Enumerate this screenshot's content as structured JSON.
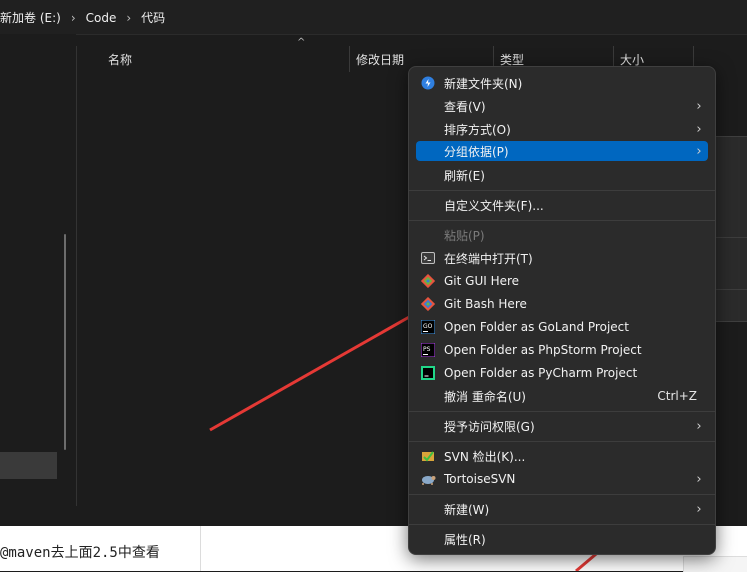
{
  "breadcrumb": {
    "items": [
      "新加卷 (E:)",
      "Code",
      "代码"
    ],
    "separator": "›"
  },
  "columns": [
    "名称",
    "修改日期",
    "类型",
    "大小"
  ],
  "context_menu": {
    "items": [
      {
        "label": "新建文件夹(N)",
        "icon": "new-folder-icon"
      },
      {
        "label": "查看(V)",
        "submenu": true
      },
      {
        "label": "排序方式(O)",
        "submenu": true
      },
      {
        "label": "分组依据(P)",
        "submenu": true,
        "highlighted": true
      },
      {
        "label": "刷新(E)"
      },
      {
        "label": "自定义文件夹(F)..."
      },
      {
        "label": "粘贴(P)",
        "disabled": true
      },
      {
        "label": "在终端中打开(T)",
        "icon": "terminal-icon"
      },
      {
        "label": "Git GUI Here",
        "icon": "git-gui-icon"
      },
      {
        "label": "Git Bash Here",
        "icon": "git-bash-icon"
      },
      {
        "label": "Open Folder as GoLand Project",
        "icon": "goland-icon"
      },
      {
        "label": "Open Folder as PhpStorm Project",
        "icon": "phpstorm-icon"
      },
      {
        "label": "Open Folder as PyCharm Project",
        "icon": "pycharm-icon"
      },
      {
        "label": "撤消 重命名(U)",
        "shortcut": "Ctrl+Z"
      },
      {
        "label": "授予访问权限(G)",
        "submenu": true
      },
      {
        "label": "SVN 检出(K)...",
        "icon": "svn-checkout-icon"
      },
      {
        "label": "TortoiseSVN",
        "icon": "tortoisesvn-icon",
        "submenu": true
      },
      {
        "label": "新建(W)",
        "submenu": true
      },
      {
        "label": "属性(R)"
      }
    ]
  },
  "icons": {
    "goland_text": "GO",
    "phpstorm_text": "PS"
  },
  "document_snippet": "@maven去上面2.5中查看",
  "colors": {
    "highlight": "#0067c0",
    "annotation_arrow": "#e53935",
    "menu_bg": "#2b2b2b"
  }
}
